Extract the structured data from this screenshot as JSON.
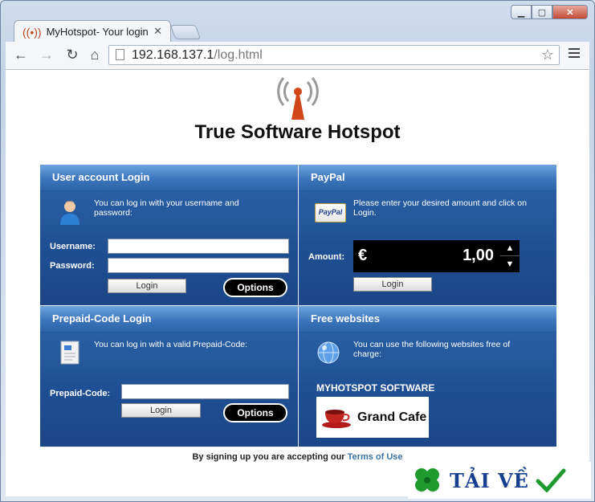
{
  "browser": {
    "tab_title": "MyHotspot- Your login",
    "url_host": "192.168.137.1",
    "url_path": "/log.html",
    "icons": [
      "back-icon",
      "forward-icon",
      "reload-icon",
      "home-icon",
      "star-icon",
      "menu-icon"
    ]
  },
  "page": {
    "brand": "True Software Hotspot",
    "user_login": {
      "title": "User account Login",
      "description": "You can log in with  your username  and password:",
      "username_label": "Username:",
      "password_label": "Password:",
      "username_value": "",
      "password_value": "",
      "login_button": "Login",
      "options_button": "Options"
    },
    "paypal": {
      "title": "PayPal",
      "description": "Please enter your desired amount and click on Login.",
      "logo_text": "PayPal",
      "amount_label": "Amount:",
      "currency": "€",
      "amount": "1,00",
      "login_button": "Login"
    },
    "prepaid": {
      "title": "Prepaid-Code Login",
      "description": "You can log in with a valid Prepaid-Code:",
      "code_label": "Prepaid-Code:",
      "code_value": "",
      "login_button": "Login",
      "options_button": "Options"
    },
    "free_sites": {
      "title": "Free websites",
      "description": "You can use the  following websites  free of charge:",
      "site_title": "MYHOTSPOT SOFTWARE",
      "site_name": "Grand Cafe"
    },
    "terms_prefix": "By signing up you are accepting our",
    "terms_link": "Terms of Use"
  },
  "watermark": {
    "text": "TẢI VỀ"
  },
  "colors": {
    "panel": "#1f4f93",
    "header": "#3d76bd",
    "antenna": "#d2461a",
    "link": "#3a73a8"
  }
}
